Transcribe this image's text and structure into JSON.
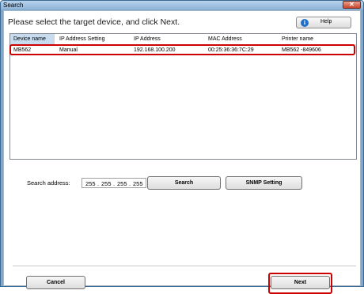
{
  "window": {
    "title": "Search",
    "close_glyph": "✕"
  },
  "instruction": "Please select the target device, and click Next.",
  "help": {
    "label": "Help",
    "icon_glyph": "i"
  },
  "device_list": {
    "columns": [
      "Device name",
      "IP Address Setting",
      "IP Address",
      "MAC Address",
      "Printer name"
    ],
    "rows": [
      [
        "MB562",
        "Manual",
        "192.168.100.200",
        "00:25:36:36:7C:29",
        "MB562 -849606"
      ]
    ]
  },
  "search": {
    "label": "Search address:",
    "octets": [
      "255",
      "255",
      "255",
      "255"
    ],
    "search_button": "Search",
    "snmp_button": "SNMP Setting"
  },
  "footer": {
    "cancel": "Cancel",
    "next": "Next"
  },
  "colors": {
    "highlight": "#cc0000",
    "title_bar": "#8db3d8",
    "help_icon": "#1e6fc6"
  }
}
